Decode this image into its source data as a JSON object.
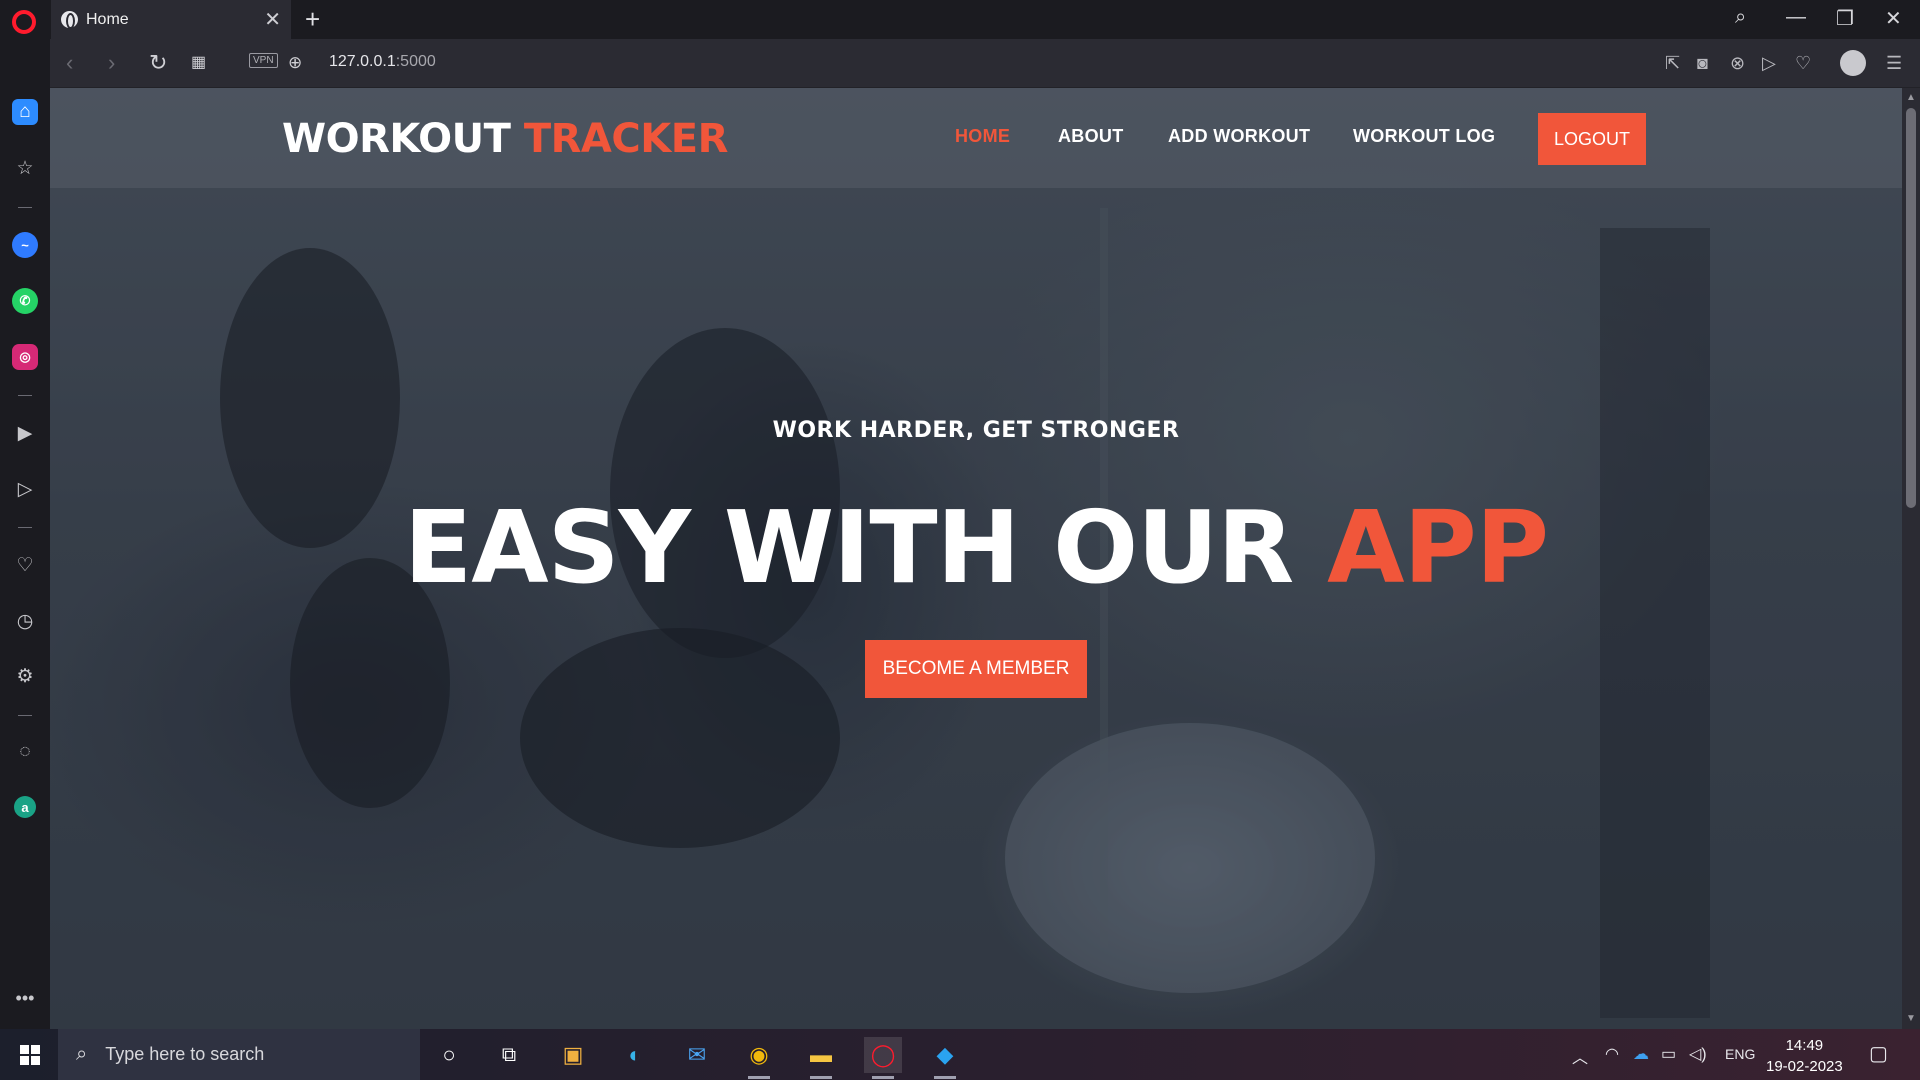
{
  "browser": {
    "tab_title": "Home",
    "url_host": "127.0.0.1",
    "url_port": ":5000",
    "vpn_label": "VPN"
  },
  "site": {
    "logo_main": "WORKOUT",
    "logo_accent": "TRACKER",
    "nav": [
      "HOME",
      "ABOUT",
      "ADD WORKOUT",
      "WORKOUT LOG"
    ],
    "active_nav": "HOME",
    "logout_label": "LOGOUT",
    "tagline": "WORK HARDER, GET STRONGER",
    "headline_main": "EASY WITH OUR",
    "headline_accent": "APP",
    "cta_label": "BECOME A MEMBER",
    "accent_color": "#f1563a"
  },
  "taskbar": {
    "search_placeholder": "Type here to search",
    "language": "ENG",
    "time": "14:49",
    "date": "19-02-2023"
  }
}
